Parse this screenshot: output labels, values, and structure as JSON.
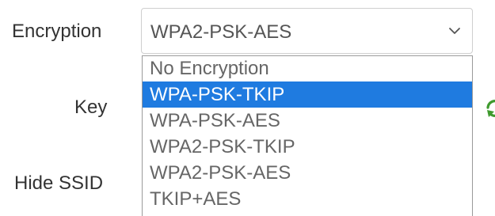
{
  "form": {
    "encryption_label": "Encryption",
    "key_label": "Key",
    "hide_ssid_label": "Hide SSID"
  },
  "encryption_select": {
    "value": "WPA2-PSK-AES",
    "options": [
      "No Encryption",
      "WPA-PSK-TKIP",
      "WPA-PSK-AES",
      "WPA2-PSK-TKIP",
      "WPA2-PSK-AES",
      "TKIP+AES"
    ],
    "highlighted_option": "WPA-PSK-TKIP"
  },
  "icons": {
    "select_arrow": "chevron-down-icon",
    "key_action": "refresh-icon"
  },
  "colors": {
    "highlight": "#1f7be0",
    "refresh_icon": "#3f9a2e"
  }
}
